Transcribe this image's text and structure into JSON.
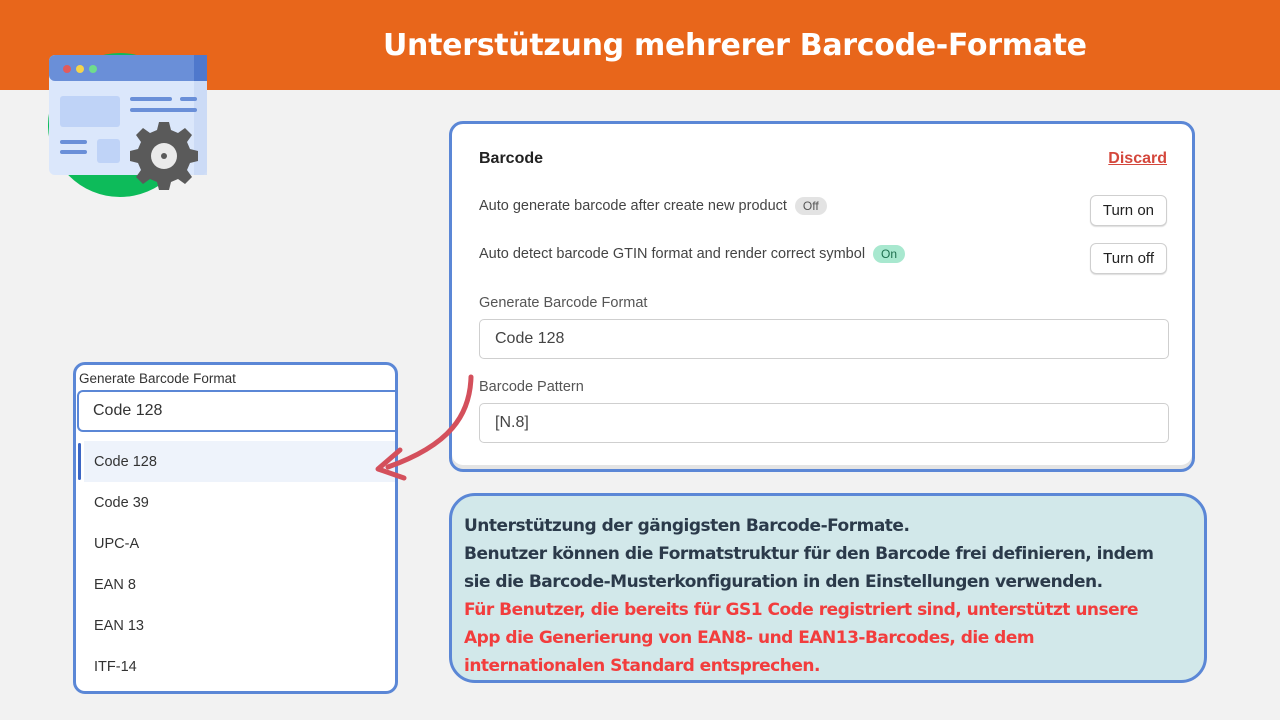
{
  "header": {
    "title": "Unterstützung mehrerer Barcode-Formate",
    "background_color": "#e8661b"
  },
  "app_icon": {
    "name": "browser-settings-icon"
  },
  "settings_card": {
    "title": "Barcode",
    "discard_label": "Discard",
    "settings": [
      {
        "label": "Auto generate barcode after create new product",
        "status": "Off",
        "button_label": "Turn on"
      },
      {
        "label": "Auto detect barcode GTIN format and render correct symbol",
        "status": "On",
        "button_label": "Turn off"
      }
    ],
    "format_field": {
      "label": "Generate Barcode Format",
      "value": "Code 128"
    },
    "pattern_field": {
      "label": "Barcode Pattern",
      "value": "[N.8]"
    }
  },
  "dropdown": {
    "label": "Generate Barcode Format",
    "selected": "Code 128",
    "options": [
      "Code 128",
      "Code 39",
      "UPC-A",
      "EAN 8",
      "EAN 13",
      "ITF-14"
    ]
  },
  "note": {
    "lines_dark": [
      "Unterstützung der gängigsten Barcode-Formate.",
      "Benutzer können die Formatstruktur für den Barcode frei definieren, indem",
      "sie die Barcode-Musterkonfiguration in den Einstellungen verwenden."
    ],
    "lines_red": [
      "Für Benutzer, die bereits für GS1 Code registriert sind, unterstützt unsere",
      "App die Generierung von EAN8- und EAN13-Barcodes, die dem",
      "internationalen Standard entsprechen."
    ],
    "accent_color": "#f23d3d"
  }
}
